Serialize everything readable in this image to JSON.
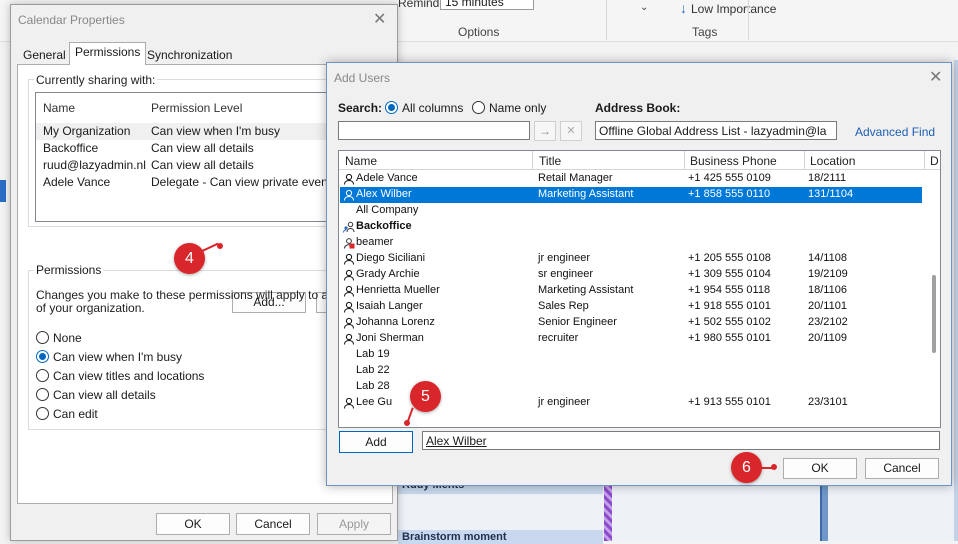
{
  "background": {
    "reminder_label": "Reminder:",
    "reminder_value": "15 minutes",
    "options_group": "Options",
    "low_importance": "Low Importance",
    "tags_group": "Tags",
    "event1": "Ruuy Ments",
    "event2": "Brainstorm moment"
  },
  "calendar_properties": {
    "title": "Calendar Properties",
    "tabs": [
      "General",
      "Permissions",
      "Synchronization"
    ],
    "sharing_label": "Currently sharing with:",
    "columns": [
      "Name",
      "Permission Level"
    ],
    "rows": [
      {
        "name": "My Organization",
        "level": "Can view when I'm busy"
      },
      {
        "name": "Backoffice",
        "level": "Can view all details"
      },
      {
        "name": "ruud@lazyadmin.nl",
        "level": "Can view all details"
      },
      {
        "name": "Adele Vance",
        "level": "Delegate - Can view private events"
      }
    ],
    "add_button": "Add...",
    "remove_button": "R",
    "permissions_label": "Permissions",
    "permissions_desc": "Changes you make to these permissions will apply to all of your organization.",
    "radios": [
      "None",
      "Can view when I'm busy",
      "Can view titles and locations",
      "Can view all details",
      "Can edit"
    ],
    "selected_radio": 1,
    "ok": "OK",
    "cancel": "Cancel",
    "apply": "Apply"
  },
  "add_users": {
    "title": "Add Users",
    "search_label": "Search:",
    "search_all": "All columns",
    "search_name": "Name only",
    "search_value": "",
    "address_book_label": "Address Book:",
    "address_book_value": "Offline Global Address List - lazyadmin@la",
    "advanced_find": "Advanced Find",
    "columns": [
      "Name",
      "Title",
      "Business Phone",
      "Location",
      "D"
    ],
    "rows": [
      {
        "name": "Adele Vance",
        "title": "Retail Manager",
        "phone": "+1 425 555 0109",
        "location": "18/2111",
        "icon": "user-icon",
        "bold": false
      },
      {
        "name": "Alex Wilber",
        "title": "Marketing Assistant",
        "phone": "+1 858 555 0110",
        "location": "131/1104",
        "icon": "user-icon",
        "bold": false
      },
      {
        "name": "All Company",
        "title": "",
        "phone": "",
        "location": "",
        "icon": "",
        "bold": false
      },
      {
        "name": "Backoffice",
        "title": "",
        "phone": "",
        "location": "",
        "icon": "group-icon",
        "bold": true
      },
      {
        "name": "beamer",
        "title": "",
        "phone": "",
        "location": "",
        "icon": "resource-icon",
        "bold": false
      },
      {
        "name": "Diego Siciliani",
        "title": "jr engineer",
        "phone": "+1 205 555 0108",
        "location": "14/1108",
        "icon": "user-icon",
        "bold": false
      },
      {
        "name": "Grady Archie",
        "title": "sr engineer",
        "phone": "+1 309 555 0104",
        "location": "19/2109",
        "icon": "user-icon",
        "bold": false
      },
      {
        "name": "Henrietta Mueller",
        "title": "Marketing Assistant",
        "phone": "+1 954 555 0118",
        "location": "18/1106",
        "icon": "user-icon",
        "bold": false
      },
      {
        "name": "Isaiah Langer",
        "title": "Sales Rep",
        "phone": "+1 918 555 0101",
        "location": "20/1101",
        "icon": "user-icon",
        "bold": false
      },
      {
        "name": "Johanna Lorenz",
        "title": "Senior Engineer",
        "phone": "+1 502 555 0102",
        "location": "23/2102",
        "icon": "user-icon",
        "bold": false
      },
      {
        "name": "Joni Sherman",
        "title": "recruiter",
        "phone": "+1 980 555 0101",
        "location": "20/1109",
        "icon": "user-icon",
        "bold": false
      },
      {
        "name": "Lab 19",
        "title": "",
        "phone": "",
        "location": "",
        "icon": "",
        "bold": false
      },
      {
        "name": "Lab 22",
        "title": "",
        "phone": "",
        "location": "",
        "icon": "",
        "bold": false
      },
      {
        "name": "Lab 28",
        "title": "",
        "phone": "",
        "location": "",
        "icon": "",
        "bold": false
      },
      {
        "name": "Lee Gu",
        "title": "jr engineer",
        "phone": "+1 913 555 0101",
        "location": "23/3101",
        "icon": "user-icon",
        "bold": false
      }
    ],
    "selected_row": 1,
    "add_button": "Add",
    "added_value": "Alex Wilber",
    "ok": "OK",
    "cancel": "Cancel"
  },
  "markers": [
    "4",
    "5",
    "6"
  ],
  "colors": {
    "accent": "#0078d7",
    "marker": "#d9262b",
    "link": "#1e5fb4"
  }
}
